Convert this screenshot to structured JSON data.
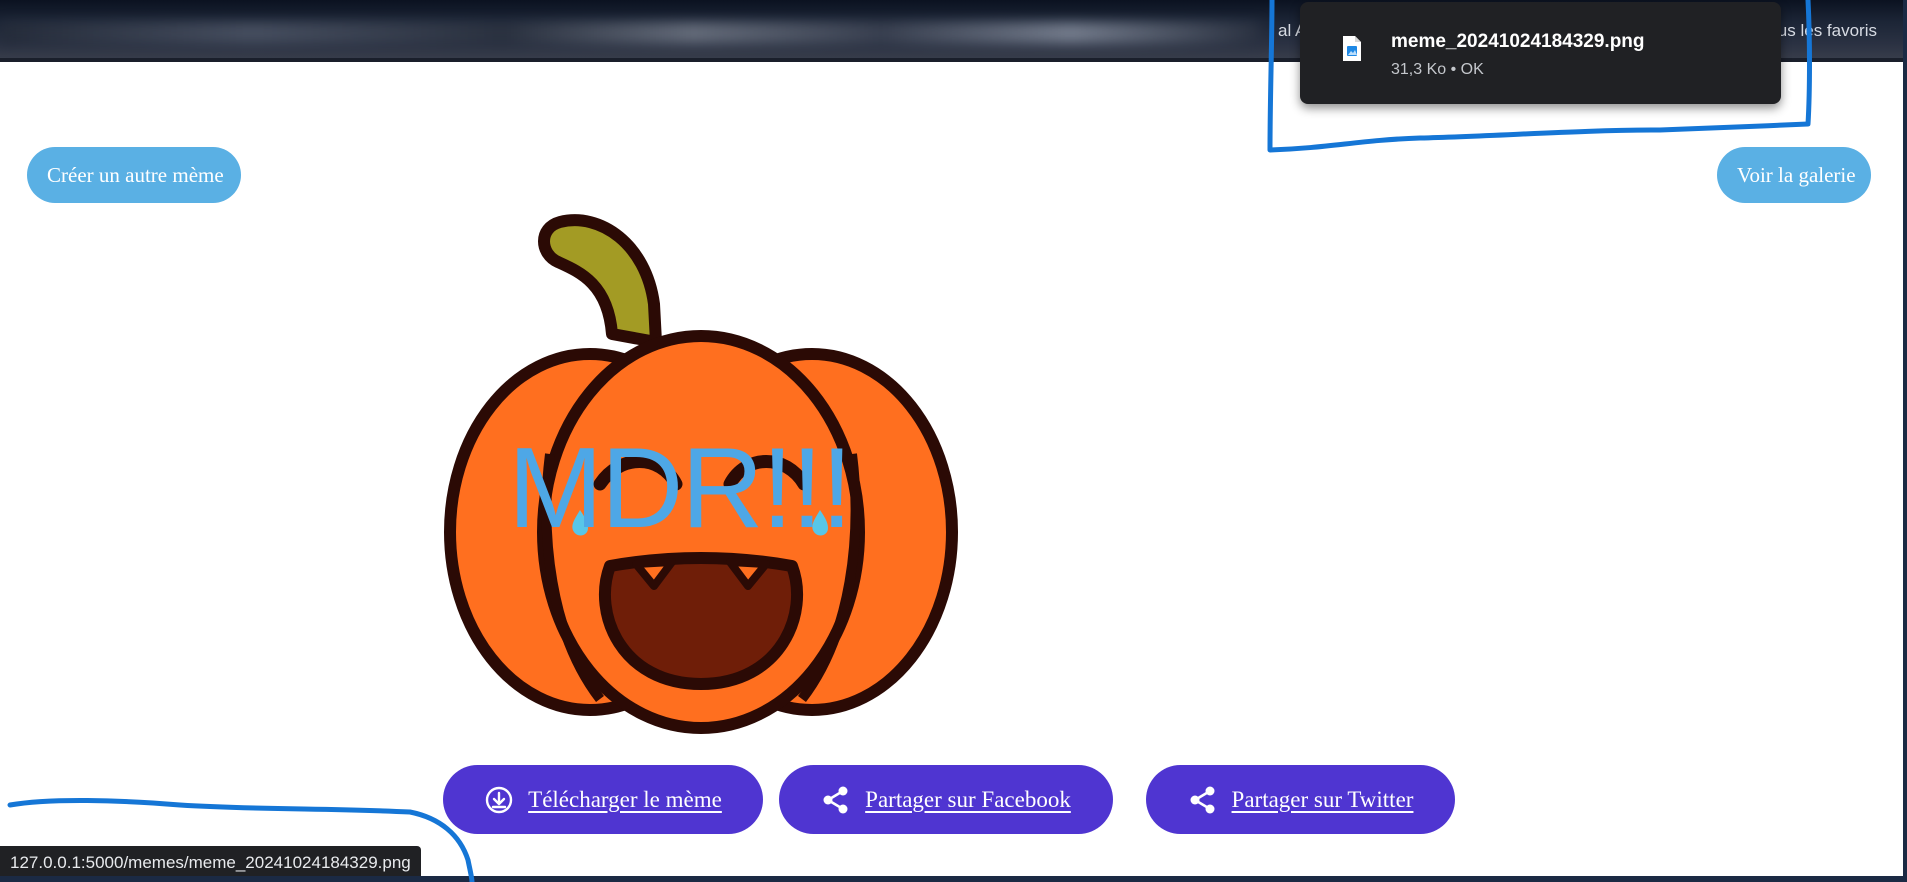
{
  "browser": {
    "bookmark_left_fragment": "al An",
    "bookmark_right_fragment": "us les favoris"
  },
  "download": {
    "filename": "meme_20241024184329.png",
    "meta": "31,3 Ko • OK",
    "icon": "image-file-icon"
  },
  "nav": {
    "create_label": "Créer un autre mème",
    "gallery_label": "Voir la galerie"
  },
  "meme": {
    "caption": "MDR!!!",
    "image": "pumpkin-laughing-image"
  },
  "actions": {
    "download_label": "Télécharger le mème",
    "download_icon": "download-cloud-icon",
    "facebook_label": "Partager sur Facebook",
    "facebook_icon": "share-icon",
    "twitter_label": "Partager sur Twitter",
    "twitter_icon": "share-icon"
  },
  "status": {
    "url": "127.0.0.1:5000/memes/meme_20241024184329.png"
  },
  "colors": {
    "pill": "#5ab0e4",
    "action": "#4f35d1",
    "annotation": "#1576d6",
    "pumpkin": "#ff6f1f",
    "caption": "#4ea7e6"
  }
}
